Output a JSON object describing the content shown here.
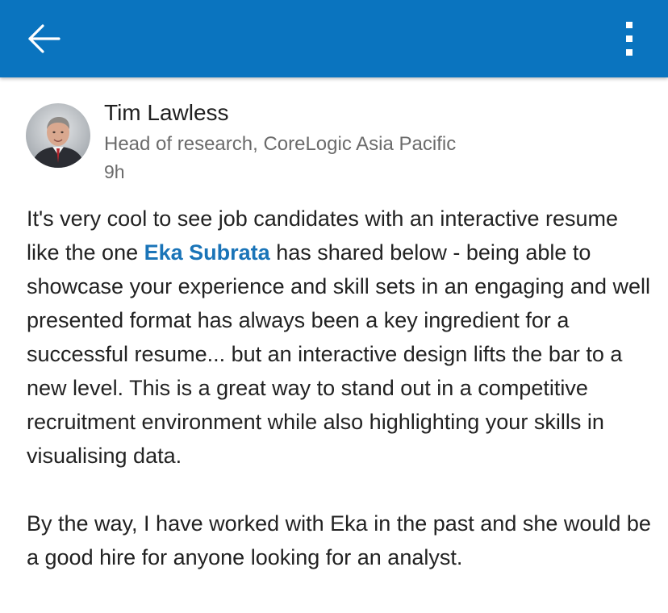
{
  "colors": {
    "app_bar": "#0a74bf",
    "mention_link": "#1a74b8",
    "secondary_text": "#6b6b6b",
    "body_text": "#222222"
  },
  "toolbar": {
    "back_icon": "arrow-left-icon",
    "more_icon": "vertical-ellipsis-icon"
  },
  "post": {
    "author": {
      "name": "Tim Lawless",
      "headline": "Head of research, CoreLogic Asia Pacific",
      "avatar_icon": "profile-photo"
    },
    "time_ago": "9h",
    "body": {
      "p1_before_mention": "It's very cool to see job candidates with an interactive resume like the one ",
      "mention": "Eka Subrata",
      "p1_after_mention": " has shared below - being able to showcase your experience and skill sets in an engaging and well presented format has always been a key ingredient for a successful resume... but an interactive design lifts the bar to a new level.  This is a great way to stand out in a competitive recruitment environment while also highlighting your skills in visualising data.",
      "p2": "By the way, I have worked with Eka in the past and she would be a good hire for anyone looking for an analyst."
    }
  }
}
